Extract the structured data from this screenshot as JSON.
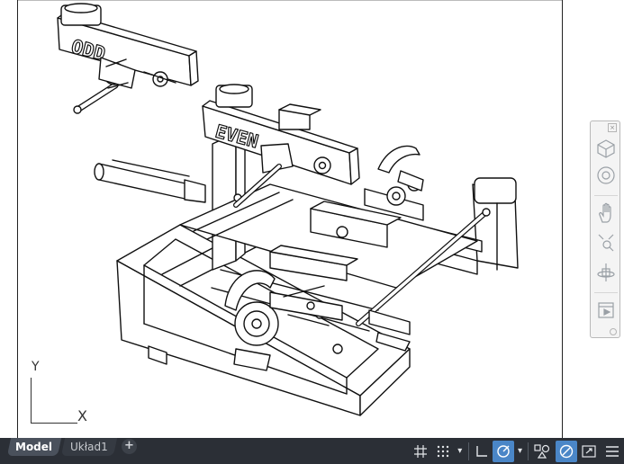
{
  "drawing": {
    "label_odd": "ODD",
    "label_even": "EVEN"
  },
  "ucs": {
    "y_axis": "Y",
    "x_axis": "X"
  },
  "navbar": {
    "close_glyph": "×",
    "items": [
      "viewcube-icon",
      "steeringwheel-icon",
      "pan-icon",
      "zoom-icon",
      "orbit-icon",
      "showmotion-icon"
    ]
  },
  "statusbar": {
    "tabs": [
      {
        "label": "Model",
        "active": true
      },
      {
        "label": "Układ1",
        "active": false
      }
    ],
    "add_tab": "+",
    "dropdown_glyph": "▾",
    "accent_color": "#4a86c7",
    "background_color": "#2b2f36"
  }
}
